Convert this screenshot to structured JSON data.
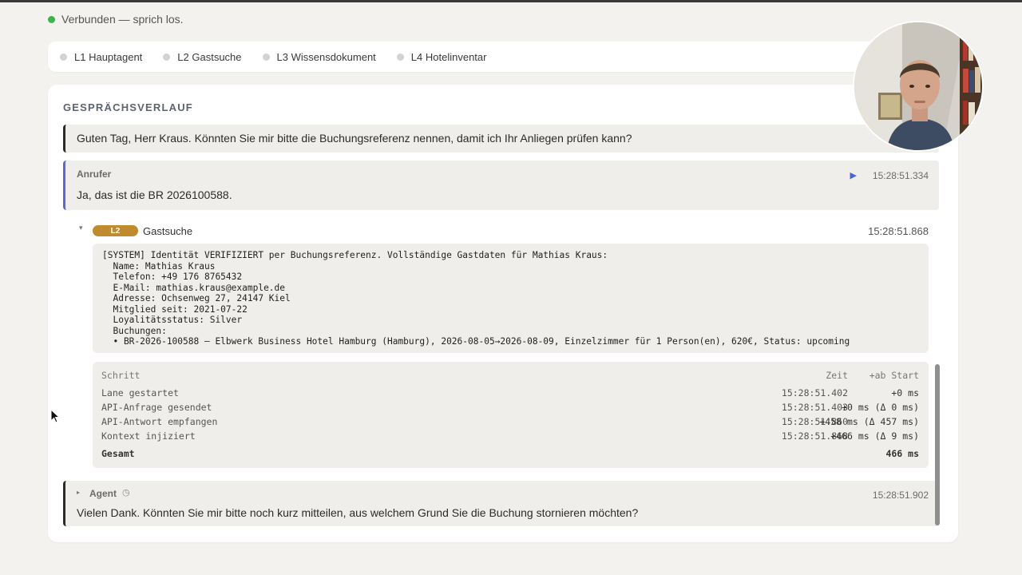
{
  "status": {
    "text": "Verbunden — sprich los.",
    "color": "#3bb54a"
  },
  "lanes": [
    {
      "label": "L1 Hauptagent"
    },
    {
      "label": "L2 Gastsuche"
    },
    {
      "label": "L3 Wissensdokument"
    },
    {
      "label": "L4 Hotelinventar"
    }
  ],
  "panel": {
    "title": "GESPRÄCHSVERLAUF"
  },
  "messages": {
    "agent_greeting": {
      "text": "Guten Tag, Herr Kraus. Könnten Sie mir bitte die Buchungsreferenz nennen, damit ich Ihr Anliegen prüfen kann?"
    },
    "caller": {
      "label": "Anrufer",
      "time": "15:28:51.334",
      "text": "Ja, das ist die BR 2026100588."
    },
    "agent_reply": {
      "label": "Agent",
      "time": "15:28:51.902",
      "text": "Vielen Dank. Könnten Sie mir bitte noch kurz mitteilen, aus welchem Grund Sie die Buchung stornieren möchten?"
    }
  },
  "tool_call": {
    "badge": "L2",
    "name": "Gastsuche",
    "time": "15:28:51.868",
    "output": "[SYSTEM] Identität VERIFIZIERT per Buchungsreferenz. Vollständige Gastdaten für Mathias Kraus:\n  Name: Mathias Kraus\n  Telefon: +49 176 8765432\n  E-Mail: mathias.kraus@example.de\n  Adresse: Ochsenweg 27, 24147 Kiel\n  Mitglied seit: 2021-07-22\n  Loyalitätsstatus: Silver\n  Buchungen:\n  • BR-2026-100588 — Elbwerk Business Hotel Hamburg (Hamburg), 2026-08-05→2026-08-09, Einzelzimmer für 1 Person(en), 620€, Status: upcoming"
  },
  "timing": {
    "headers": {
      "step": "Schritt",
      "time": "Zeit",
      "delta": "+ab Start"
    },
    "rows": [
      {
        "step": "Lane gestartet",
        "time": "15:28:51.402",
        "delta": "+0 ms"
      },
      {
        "step": "API-Anfrage gesendet",
        "time": "15:28:51.403",
        "delta": "+0 ms (Δ 0 ms)"
      },
      {
        "step": "API-Antwort empfangen",
        "time": "15:28:51.860",
        "delta": "+458 ms (Δ 457 ms)"
      },
      {
        "step": "Kontext injiziert",
        "time": "15:28:51.868",
        "delta": "+466 ms (Δ 9 ms)"
      }
    ],
    "total": {
      "label": "Gesamt",
      "value": "466 ms"
    }
  },
  "colors": {
    "lane_badge": "#c08a2f",
    "caller_accent": "#5a67d8",
    "agent_accent": "#2a2a2a"
  }
}
